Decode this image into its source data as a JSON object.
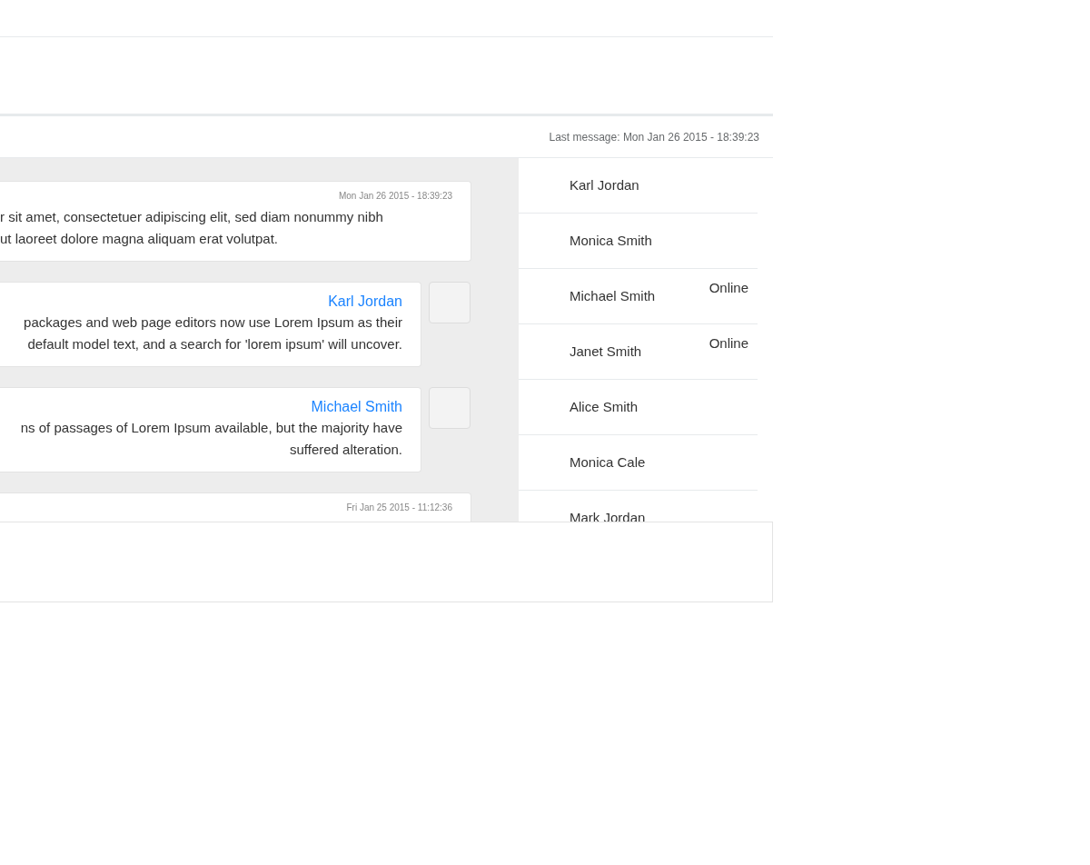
{
  "chat": {
    "last_message": "Last message: Mon Jan 26 2015 - 18:39:23",
    "messages": [
      {
        "kind": "left",
        "date": "Mon Jan 26 2015 - 18:39:23",
        "text": "r sit amet, consectetuer adipiscing elit, sed diam nonummy nibh\n ut laoreet dolore magna aliquam erat volutpat."
      },
      {
        "kind": "right",
        "author": "Karl Jordan",
        "text": " packages and web page editors now use Lorem Ipsum as their\ndefault model text, and a search for 'lorem ipsum' will uncover."
      },
      {
        "kind": "right",
        "author": "Michael Smith",
        "text": "ns of passages of Lorem Ipsum available, but the majority have\nsuffered alteration."
      },
      {
        "kind": "left",
        "date": "Fri Jan 25 2015 - 11:12:36"
      }
    ],
    "users": [
      {
        "name": "Karl Jordan"
      },
      {
        "name": "Monica Smith"
      },
      {
        "name": "Michael Smith",
        "status": "Online"
      },
      {
        "name": "Janet Smith",
        "status": "Online"
      },
      {
        "name": "Alice Smith"
      },
      {
        "name": "Monica Cale"
      },
      {
        "name": "Mark Jordan"
      }
    ]
  }
}
